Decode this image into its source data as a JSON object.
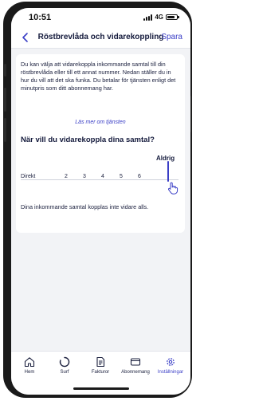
{
  "status_bar": {
    "time": "10:51",
    "network": "4G",
    "battery_level": 0.85
  },
  "header": {
    "title": "Röstbrevlåda och vidarekoppling",
    "save_label": "Spara",
    "back_icon": "chevron-left-icon"
  },
  "forwarding": {
    "intro": "Du kan välja att vidarekoppla inkommande samtal till din röstbrevlåda eller till ett annat nummer. Nedan ställer du in hur du vill att det ska funka. Du betalar för tjänsten enligt det minutpris som ditt abonnemang har.",
    "read_more": "Läs mer om tjänsten",
    "question": "När vill du vidarekoppla dina samtal?",
    "slider": {
      "options": [
        "Direkt",
        "2",
        "3",
        "4",
        "5",
        "6",
        "Aldrig"
      ],
      "selected": "Aldrig"
    },
    "result_text": "Dina inkommande samtal kopplas inte vidare alls."
  },
  "tabs": [
    {
      "label": "Hem",
      "icon": "home-icon",
      "active": false
    },
    {
      "label": "Surf",
      "icon": "data-usage-icon",
      "active": false
    },
    {
      "label": "Fakturor",
      "icon": "invoice-icon",
      "active": false
    },
    {
      "label": "Abonnemang",
      "icon": "subscription-icon",
      "active": false
    },
    {
      "label": "Inställningar",
      "icon": "gear-icon",
      "active": true
    }
  ],
  "colors": {
    "accent": "#3a3ec6",
    "text_dark": "#141a3c",
    "background": "#f2f3f6"
  }
}
